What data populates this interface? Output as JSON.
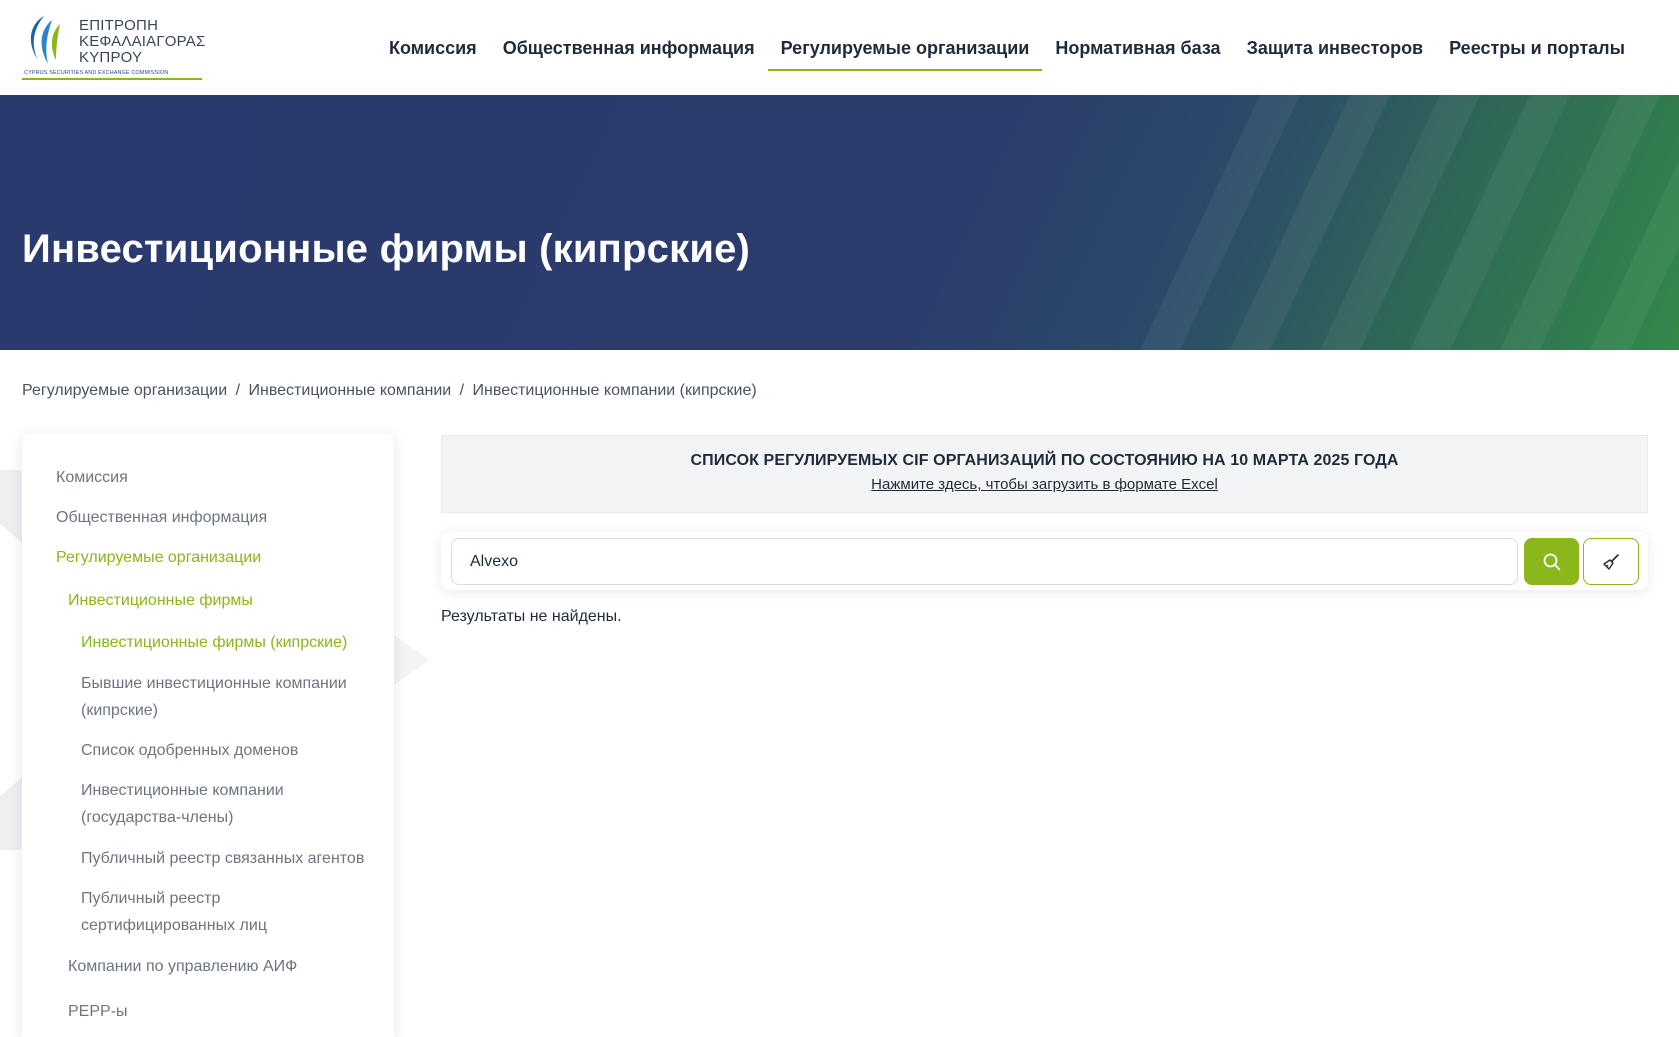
{
  "header": {
    "logo": {
      "lines": [
        "ΕΠΙΤΡΟΠΗ",
        "ΚΕΦΑΛΑΙΑΓΟΡΑΣ",
        "ΚΥΠΡΟΥ"
      ],
      "subtitle": "CYPRUS SECURITIES AND EXCHANGE COMMISSION"
    },
    "nav": [
      {
        "label": "Комиссия",
        "active": false
      },
      {
        "label": "Общественная информация",
        "active": false
      },
      {
        "label": "Регулируемые организации",
        "active": true
      },
      {
        "label": "Нормативная база",
        "active": false
      },
      {
        "label": "Защита инвесторов",
        "active": false
      },
      {
        "label": "Реестры и порталы",
        "active": false
      }
    ]
  },
  "hero": {
    "title": "Инвестиционные фирмы (кипрские)"
  },
  "breadcrumb": {
    "items": [
      "Регулируемые организации",
      "Инвестиционные компании",
      "Инвестиционные компании (кипрские)"
    ],
    "separator": "/"
  },
  "sidebar": {
    "items": [
      {
        "label": "Комиссия",
        "active": false
      },
      {
        "label": "Общественная информация",
        "active": false
      },
      {
        "label": "Регулируемые организации",
        "active": true
      },
      {
        "label": "Инвестиционные фирмы",
        "active": true
      },
      {
        "label": "Инвестиционные фирмы (кипрские)",
        "active": true
      },
      {
        "label": "Бывшие инвестиционные компании (кипрские)",
        "active": false
      },
      {
        "label": "Список одобренных доменов",
        "active": false
      },
      {
        "label": "Инвестиционные компании (государства-члены)",
        "active": false
      },
      {
        "label": "Публичный реестр связанных агентов",
        "active": false
      },
      {
        "label": "Публичный реестр сертифицированных лиц",
        "active": false
      },
      {
        "label": "Компании по управлению АИФ",
        "active": false
      },
      {
        "label": "PEPP-ы",
        "active": false
      }
    ]
  },
  "notice": {
    "title": "СПИСОК РЕГУЛИРУЕМЫХ CIF ОРГАНИЗАЦИЙ ПО СОСТОЯНИЮ НА 10 МАРТА 2025 ГОДА",
    "download_link": "Нажмите здесь, чтобы загрузить в формате Excel"
  },
  "search": {
    "value": "Alvexo",
    "search_icon": "search-icon",
    "clear_icon": "broom-icon"
  },
  "results": {
    "message": "Результаты не найдены."
  },
  "colors": {
    "accent": "#8bb61c",
    "hero_start": "#2a3a6e",
    "hero_end": "#33894a",
    "text_dark": "#1f2b3a",
    "text_muted": "#6e7580"
  }
}
